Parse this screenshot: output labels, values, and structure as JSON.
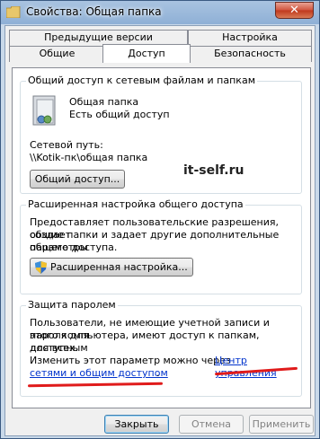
{
  "window": {
    "title": "Свойства: Общая папка",
    "close_glyph": "✕"
  },
  "tabs": {
    "back_row": [
      "Предыдущие версии",
      "Настройка"
    ],
    "front_row": [
      "Общие",
      "Доступ",
      "Безопасность"
    ],
    "active": "Доступ"
  },
  "network_sharing": {
    "title": "Общий доступ к сетевым файлам и папкам",
    "folder_name": "Общая папка",
    "folder_status": "Есть общий доступ",
    "path_label": "Сетевой путь:",
    "path_value": "\\\\Kotik-пк\\общая папка",
    "share_button": "Общий доступ..."
  },
  "watermark": "it-self.ru",
  "advanced_sharing": {
    "title": "Расширенная настройка общего доступа",
    "description_1": "Предоставляет пользовательские разрешения, создает",
    "description_2": "общие папки и задает другие дополнительные параметры",
    "description_3": "общего доступа.",
    "button": "Расширенная настройка..."
  },
  "password_protection": {
    "title": "Защита паролем",
    "line_1": "Пользователи, не имеющие учетной записи и пароля для",
    "line_2": "этого компьютера, имеют доступ к папкам, доступным",
    "line_3": "для всех.",
    "line_4_text": "Изменить этот параметр можно через ",
    "link_part_1": "Центр управления",
    "link_part_2": "сетями и общим доступом",
    "line_5_end": "."
  },
  "buttons": {
    "close": "Закрыть",
    "cancel": "Отмена",
    "apply": "Применить"
  },
  "colors": {
    "annotation_red": "#e01b1b",
    "link_blue": "#0033cc"
  }
}
